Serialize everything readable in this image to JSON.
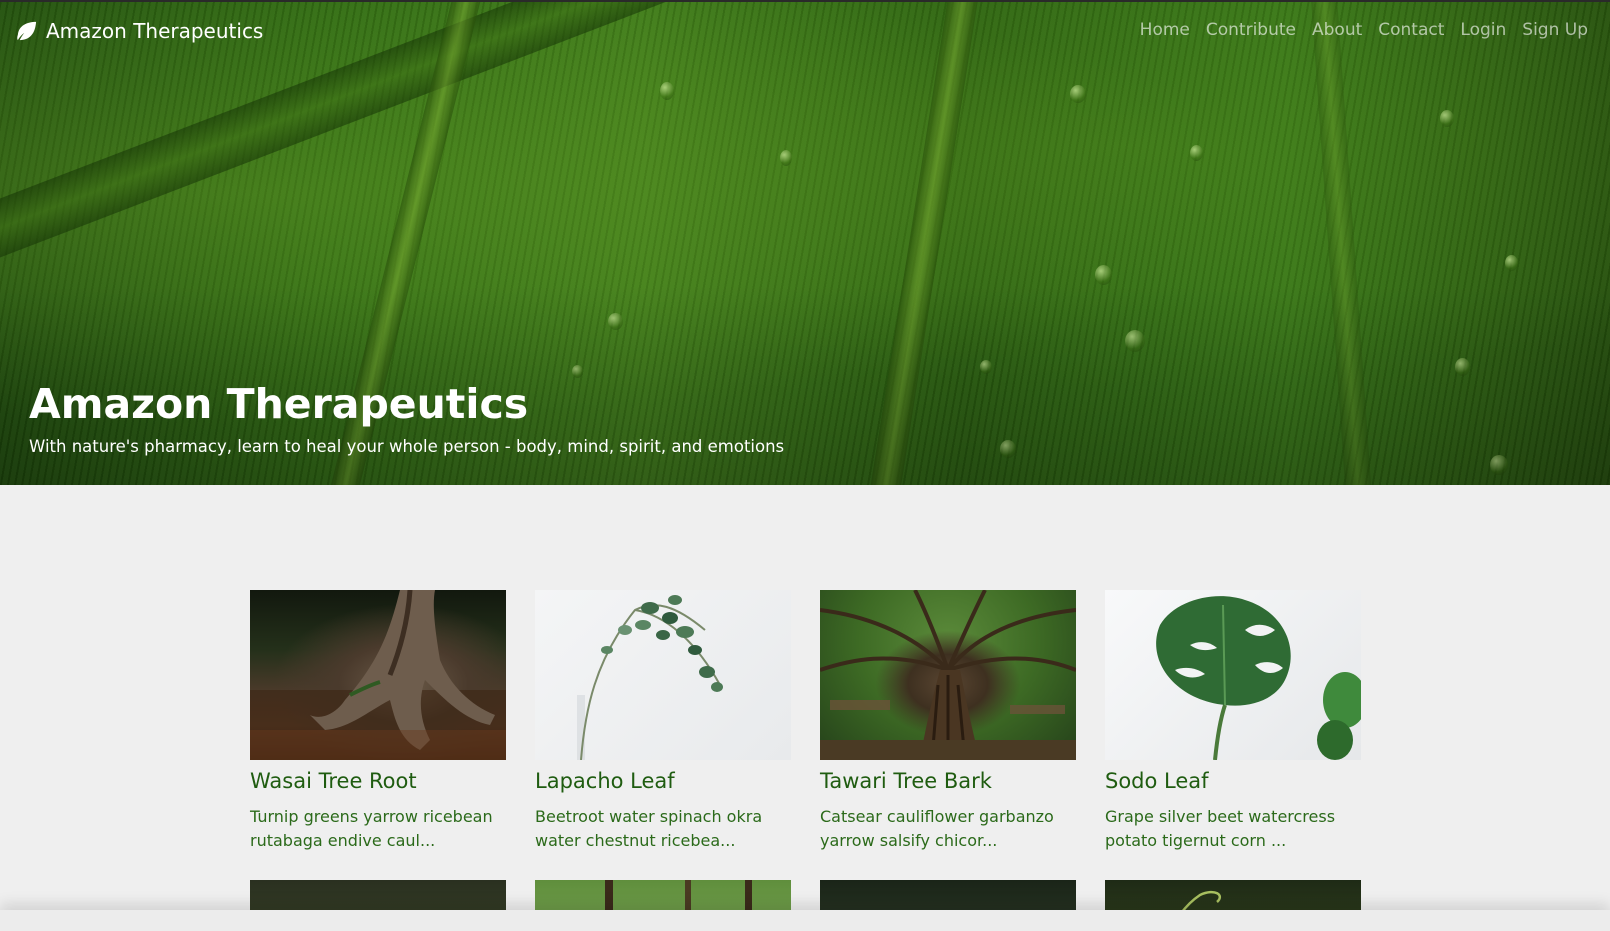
{
  "brand": {
    "name": "Amazon Therapeutics",
    "icon": "leaf-icon"
  },
  "nav": {
    "links": [
      {
        "label": "Home"
      },
      {
        "label": "Contribute"
      },
      {
        "label": "About"
      },
      {
        "label": "Contact"
      },
      {
        "label": "Login"
      },
      {
        "label": "Sign Up"
      }
    ]
  },
  "hero": {
    "title": "Amazon Therapeutics",
    "subtitle": "With nature's pharmacy, learn to heal your whole person - body, mind, spirit, and emotions"
  },
  "cards": [
    {
      "title": "Wasai Tree Root",
      "text": "Turnip greens yarrow ricebean rutabaga endive caul..."
    },
    {
      "title": "Lapacho Leaf",
      "text": "Beetroot water spinach okra water chestnut ricebea..."
    },
    {
      "title": "Tawari Tree Bark",
      "text": "Catsear cauliflower garbanzo yarrow salsify chicor..."
    },
    {
      "title": "Sodo Leaf",
      "text": "Grape silver beet watercress potato tigernut corn ..."
    }
  ],
  "colors": {
    "card_title": "#1f5c10",
    "card_text": "#2b6a1a",
    "page_bg": "#efefef"
  }
}
